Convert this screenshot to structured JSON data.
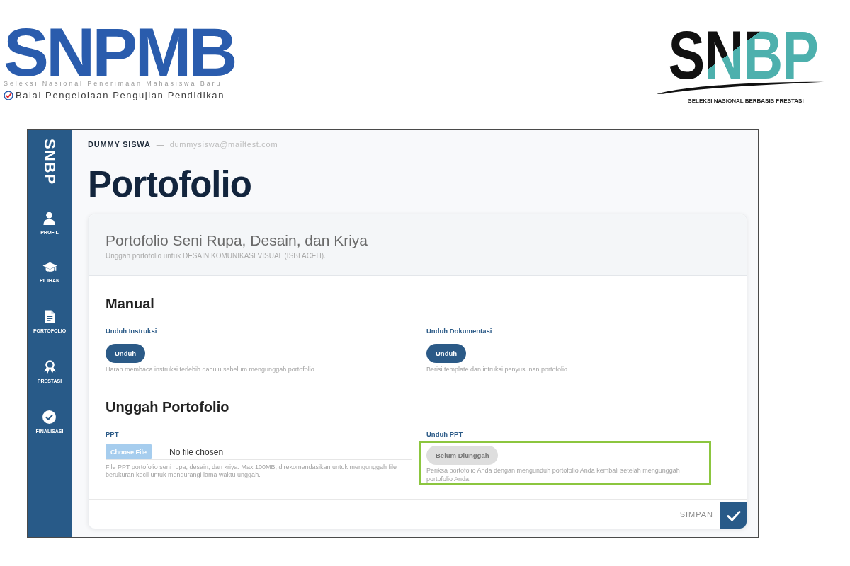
{
  "logos": {
    "left": {
      "wordmark": "SNPMB",
      "tagline": "Seleksi Nasional Penerimaan Mahasiswa Baru",
      "org": "Balai Pengelolaan Pengujian Pendidikan"
    },
    "right": {
      "wordmark": "SNBP",
      "tagline": "SELEKSI NASIONAL BERBASIS PRESTASI"
    }
  },
  "app": {
    "sidebar": {
      "brand": "SNBP",
      "items": [
        {
          "label": "PROFIL",
          "kind": "profile"
        },
        {
          "label": "PILIHAN",
          "kind": "choices"
        },
        {
          "label": "PORTOFOLIO",
          "kind": "portfolio"
        },
        {
          "label": "PRESTASI",
          "kind": "achievement"
        },
        {
          "label": "FINALISASI",
          "kind": "finalization"
        }
      ]
    },
    "user": {
      "name": "DUMMY SISWA",
      "separator": "—",
      "email": "dummysiswa@mailtest.com"
    },
    "page_title": "Portofolio",
    "card": {
      "title": "Portofolio Seni Rupa, Desain, dan Kriya",
      "subtitle": "Unggah portofolio untuk DESAIN KOMUNIKASI VISUAL (ISBI ACEH).",
      "sections": [
        {
          "heading": "Manual",
          "fields": [
            {
              "kind": "download",
              "label": "Unduh Instruksi",
              "button": "Unduh",
              "disabled": false,
              "highlighted": false,
              "help": "Harap membaca instruksi terlebih dahulu sebelum mengunggah portofolio."
            },
            {
              "kind": "download",
              "label": "Unduh Dokumentasi",
              "button": "Unduh",
              "disabled": false,
              "highlighted": false,
              "help": "Berisi template dan intruksi penyusunan portofolio."
            }
          ]
        },
        {
          "heading": "Unggah Portofolio",
          "fields": [
            {
              "kind": "file",
              "label": "PPT",
              "button": "Choose File",
              "value": "No file chosen",
              "help": "File PPT portofolio seni rupa, desain, dan kriya. Max 100MB, direkomendasikan untuk mengunggah file berukuran kecil untuk mengurangi lama waktu unggah."
            },
            {
              "kind": "download",
              "label": "Unduh PPT",
              "button": "Belum Diunggah",
              "disabled": true,
              "highlighted": true,
              "help": "Periksa portofolio Anda dengan mengunduh portofolio Anda kembali setelah mengunggah portofolio Anda."
            }
          ]
        }
      ],
      "footer": {
        "save_label": "SIMPAN"
      }
    }
  }
}
